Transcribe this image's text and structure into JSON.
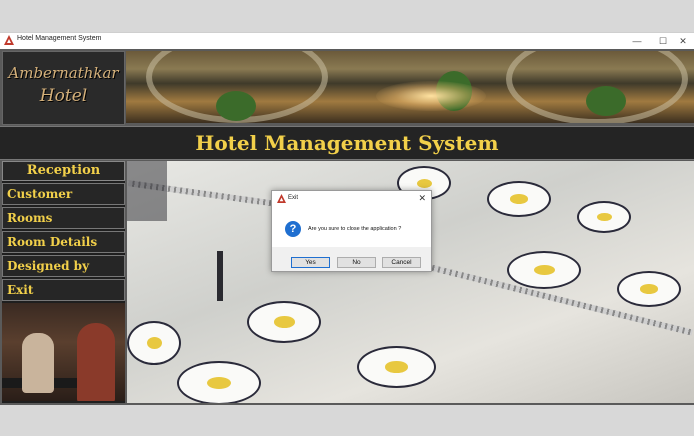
{
  "window": {
    "title": "Hotel Management System",
    "controls": {
      "minimize": "—",
      "maximize": "☐",
      "close": "✕"
    }
  },
  "logo": {
    "line1": "Ambernathkar",
    "line2": "Hotel"
  },
  "header": {
    "title": "Hotel Management System"
  },
  "sidebar": {
    "heading": "Reception",
    "items": [
      {
        "label": "Customer"
      },
      {
        "label": "Rooms"
      },
      {
        "label": "Room Details"
      },
      {
        "label": "Designed by"
      },
      {
        "label": "Exit"
      }
    ]
  },
  "dialog": {
    "title": "Exit",
    "close": "✕",
    "icon": "question-icon",
    "icon_glyph": "?",
    "message": "Are you sure to close the application ?",
    "buttons": {
      "yes": "Yes",
      "no": "No",
      "cancel": "Cancel"
    }
  },
  "colors": {
    "accent_text": "#f2d04a",
    "panel_bg": "#262626",
    "dialog_accent": "#1f6fd0"
  }
}
